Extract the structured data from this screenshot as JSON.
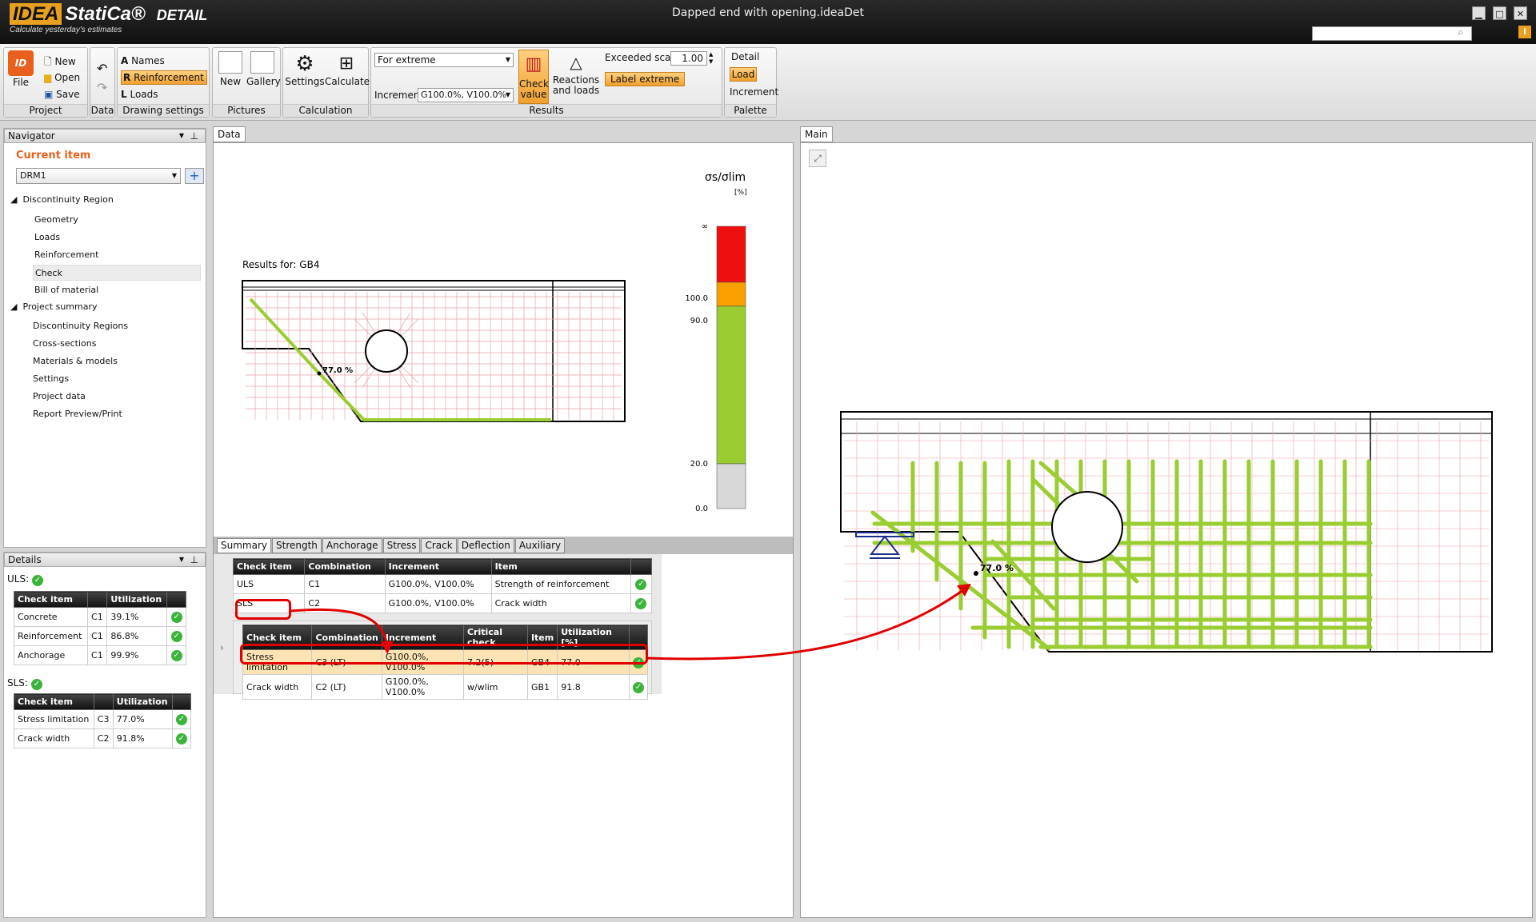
{
  "app": {
    "logo": "IDEA",
    "brand": "StatiCa®",
    "product": "DETAIL",
    "slogan": "Calculate yesterday's estimates",
    "window_title": "Dapped end with opening.ideaDet"
  },
  "ribbon": {
    "project": {
      "file": "File",
      "new": "New",
      "open": "Open",
      "save": "Save",
      "label": "Project"
    },
    "data": {
      "label": "Data"
    },
    "drawing": {
      "names": "Names",
      "reinforcement": "Reinforcement",
      "loads": "Loads",
      "label": "Drawing settings"
    },
    "pictures": {
      "new": "New",
      "gallery": "Gallery",
      "label": "Pictures"
    },
    "calculation": {
      "settings": "Settings",
      "calculate": "Calculate",
      "label": "Calculation"
    },
    "results": {
      "extreme": "For extreme",
      "increment_label": "Increment",
      "increment_value": "G100.0%, V100.0%",
      "check_value_1": "Check",
      "check_value_2": "value",
      "reactions_1": "Reactions",
      "reactions_2": "and loads",
      "exceeded_scale": "Exceeded scale",
      "scale_value": "1.00",
      "label_extreme": "Label extreme",
      "label": "Results"
    },
    "palette": {
      "detail": "Detail",
      "load": "Load",
      "increment": "Increment",
      "label": "Palette"
    }
  },
  "navigator": {
    "title": "Navigator",
    "current_item": "Current item",
    "item": "DRM1",
    "region": "Discontinuity Region",
    "region_items": [
      "Geometry",
      "Loads",
      "Reinforcement",
      "Check",
      "Bill of material"
    ],
    "summary": "Project summary",
    "summary_items": [
      "Discontinuity Regions",
      "Cross-sections",
      "Materials & models",
      "Settings",
      "Project data",
      "Report Preview/Print"
    ]
  },
  "details": {
    "title": "Details",
    "uls_label": "ULS:",
    "sls_label": "SLS:",
    "headers": [
      "Check item",
      "",
      "Utilization",
      ""
    ],
    "uls": [
      {
        "item": "Concrete",
        "comb": "C1",
        "util": "39.1%"
      },
      {
        "item": "Reinforcement",
        "comb": "C1",
        "util": "86.8%"
      },
      {
        "item": "Anchorage",
        "comb": "C1",
        "util": "99.9%"
      }
    ],
    "sls": [
      {
        "item": "Stress limitation",
        "comb": "C3",
        "util": "77.0%"
      },
      {
        "item": "Crack width",
        "comb": "C2",
        "util": "91.8%"
      }
    ]
  },
  "data_panel": {
    "tab": "Data",
    "results_for": "Results for: GB4",
    "label_pct": "77.0 %",
    "legend": {
      "title": "σs/σlim",
      "unit": "[%]",
      "ticks": [
        "∞",
        "100.0",
        "90.0",
        "20.0",
        "0.0"
      ]
    },
    "tabs": [
      "Summary",
      "Strength",
      "Anchorage",
      "Stress",
      "Crack",
      "Deflection",
      "Auxiliary"
    ],
    "summary_headers": [
      "Check item",
      "Combination",
      "Increment",
      "Item",
      ""
    ],
    "summary_rows": [
      {
        "check": "ULS",
        "comb": "C1",
        "inc": "G100.0%, V100.0%",
        "item": "Strength of reinforcement"
      },
      {
        "check": "SLS",
        "comb": "C2",
        "inc": "G100.0%, V100.0%",
        "item": "Crack width"
      }
    ],
    "sub_headers": [
      "Check item",
      "Combination",
      "Increment",
      "Critical check",
      "Item",
      "Utilization [%]",
      ""
    ],
    "sub_rows": [
      {
        "check": "Stress limitation",
        "comb": "C3 (LT)",
        "inc": "G100.0%, V100.0%",
        "crit": "7.2(5)",
        "item": "GB4",
        "util": "77.0"
      },
      {
        "check": "Crack width",
        "comb": "C2 (LT)",
        "inc": "G100.0%, V100.0%",
        "crit": "w/wlim",
        "item": "GB1",
        "util": "91.8"
      }
    ]
  },
  "main_panel": {
    "tab": "Main",
    "label_pct": "77.0 %"
  },
  "colors": {
    "accent": "#f0a030",
    "green_bar": "#9acd32",
    "highlight": "#e00000"
  }
}
